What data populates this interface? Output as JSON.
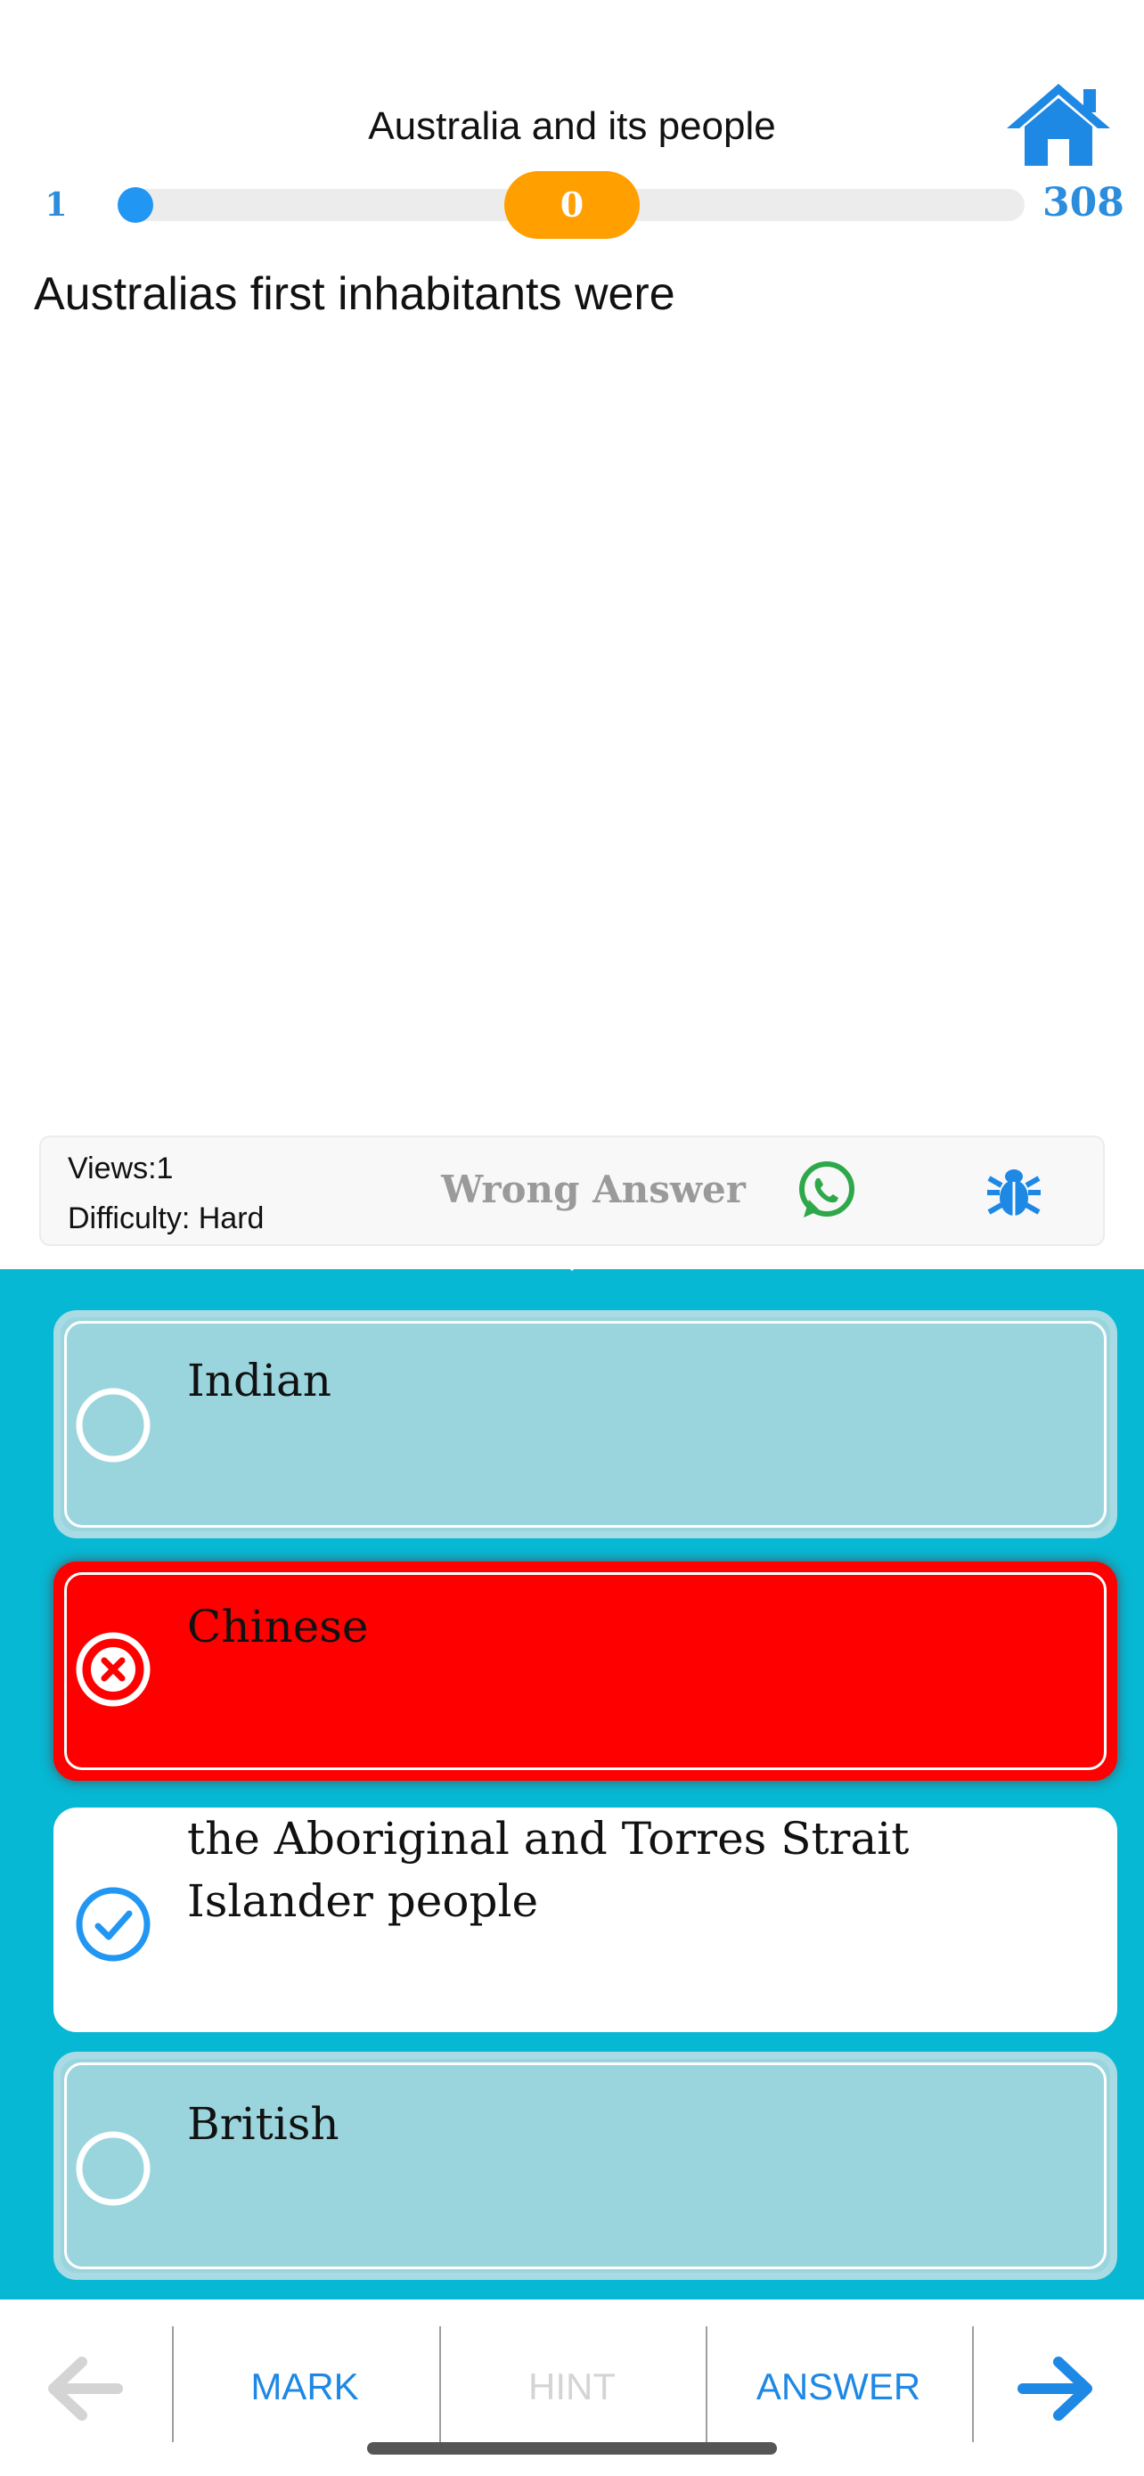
{
  "header": {
    "title": "Australia and its people",
    "home_icon": "home-icon"
  },
  "progress": {
    "min_label": "1",
    "max_label": "308",
    "current_index": 1,
    "total": 308,
    "score": "0"
  },
  "question": {
    "text": "Australias first inhabitants were"
  },
  "info": {
    "views": "Views:1",
    "difficulty": "Difficulty: Hard",
    "result": "Wrong Answer",
    "share_icon": "whatsapp-icon",
    "report_icon": "bug-icon"
  },
  "options": [
    {
      "label": "Indian",
      "state": "unselected",
      "icon": "radio-empty-icon"
    },
    {
      "label": "Chinese",
      "state": "wrong",
      "icon": "close-circle-icon"
    },
    {
      "label": "the Aboriginal and Torres Strait Islander people",
      "state": "correct",
      "icon": "check-circle-icon"
    },
    {
      "label": "British",
      "state": "unselected",
      "icon": "radio-empty-icon"
    }
  ],
  "toolbar": {
    "prev_icon": "arrow-left-icon",
    "mark": "MARK",
    "hint": "HINT",
    "answer": "ANSWER",
    "next_icon": "arrow-right-icon"
  },
  "colors": {
    "accent": "#1e88e5",
    "panel": "#06b8d3",
    "score_pill": "#ff9f00",
    "wrong": "#ff0000",
    "neutral_option": "#9ad5de"
  }
}
